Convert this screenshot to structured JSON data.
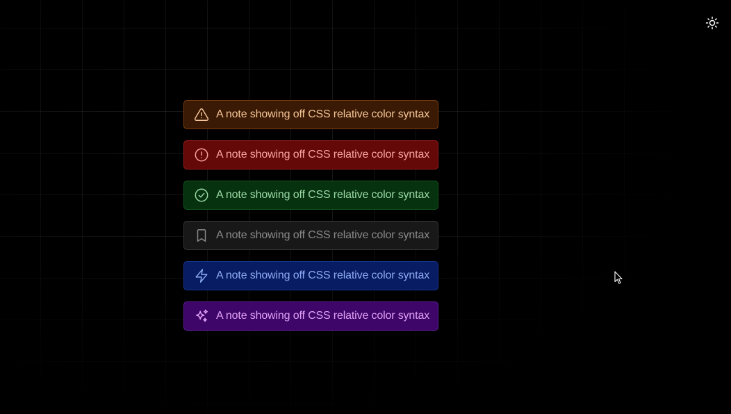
{
  "theme_toggle": {
    "icon": "sun-icon"
  },
  "notes": [
    {
      "variant": "warning",
      "icon": "warning-triangle-icon",
      "text": "A note showing off CSS relative color syntax",
      "colors": {
        "bg": "#3a1a04",
        "border": "#7a3d10",
        "fg": "#f4c496"
      }
    },
    {
      "variant": "error",
      "icon": "alert-circle-icon",
      "text": "A note showing off CSS relative color syntax",
      "colors": {
        "bg": "#650808",
        "border": "#9a1c1c",
        "fg": "#f7a3a3"
      }
    },
    {
      "variant": "success",
      "icon": "check-circle-icon",
      "text": "A note showing off CSS relative color syntax",
      "colors": {
        "bg": "#06320f",
        "border": "#13561f",
        "fg": "#9bd8a5"
      }
    },
    {
      "variant": "neutral",
      "icon": "bookmark-icon",
      "text": "A note showing off CSS relative color syntax",
      "colors": {
        "bg": "#181818",
        "border": "#363636",
        "fg": "#8a8a8a"
      }
    },
    {
      "variant": "info",
      "icon": "lightning-bolt-icon",
      "text": "A note showing off CSS relative color syntax",
      "colors": {
        "bg": "#071c62",
        "border": "#16348e",
        "fg": "#8eaaf4"
      }
    },
    {
      "variant": "magic",
      "icon": "sparkles-icon",
      "text": "A note showing off CSS relative color syntax",
      "colors": {
        "bg": "#3d0668",
        "border": "#5f1d93",
        "fg": "#e2a0f6"
      }
    }
  ]
}
